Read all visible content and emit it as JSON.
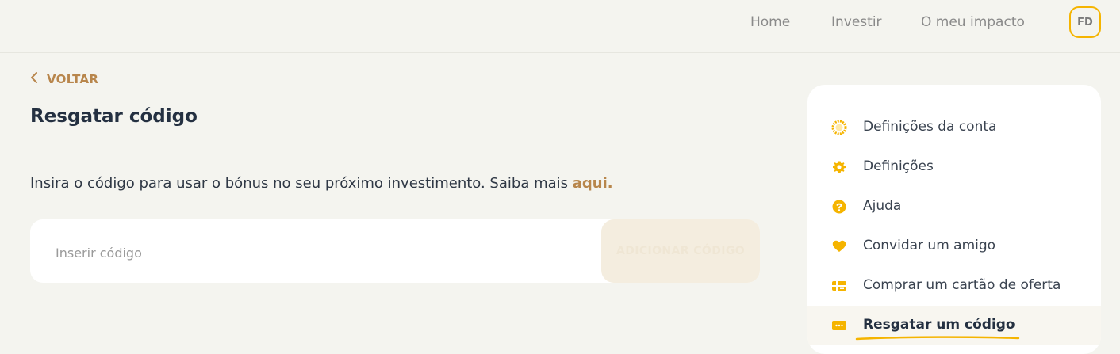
{
  "header": {
    "nav": [
      {
        "label": "Home"
      },
      {
        "label": "Investir"
      },
      {
        "label": "O meu impacto"
      }
    ],
    "avatar_initials": "FD"
  },
  "main": {
    "back_label": "VOLTAR",
    "title": "Resgatar código",
    "description": "Insira o código para usar o bónus no seu próximo investimento. Saiba mais",
    "description_link": "aqui.",
    "code_input": {
      "placeholder": "Inserir código",
      "value": ""
    },
    "add_button_label": "ADICIONAR CÓDIGO"
  },
  "sidebar": {
    "items": [
      {
        "label": "Definições da conta",
        "icon": "account-settings-icon",
        "active": false
      },
      {
        "label": "Definições",
        "icon": "gear-icon",
        "active": false
      },
      {
        "label": "Ajuda",
        "icon": "help-icon",
        "active": false
      },
      {
        "label": "Convidar um amigo",
        "icon": "heart-icon",
        "active": false
      },
      {
        "label": "Comprar um cartão de oferta",
        "icon": "gift-card-icon",
        "active": false
      },
      {
        "label": "Resgatar um código",
        "icon": "redeem-code-icon",
        "active": true
      }
    ]
  },
  "colors": {
    "accent": "#f5b400",
    "link": "#b8864c",
    "background": "#f4f4ef",
    "text_dark": "#243041"
  }
}
